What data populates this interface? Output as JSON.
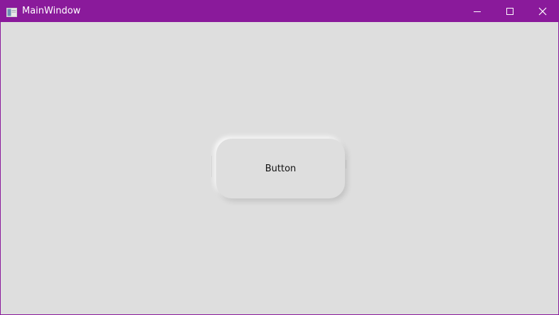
{
  "window": {
    "title": "MainWindow",
    "accent_color": "#8a1a9b",
    "background_color": "#dedede",
    "controls": {
      "minimize_icon": "minimize-icon",
      "maximize_icon": "maximize-icon",
      "close_icon": "close-icon"
    }
  },
  "main": {
    "button_label": "Button"
  }
}
